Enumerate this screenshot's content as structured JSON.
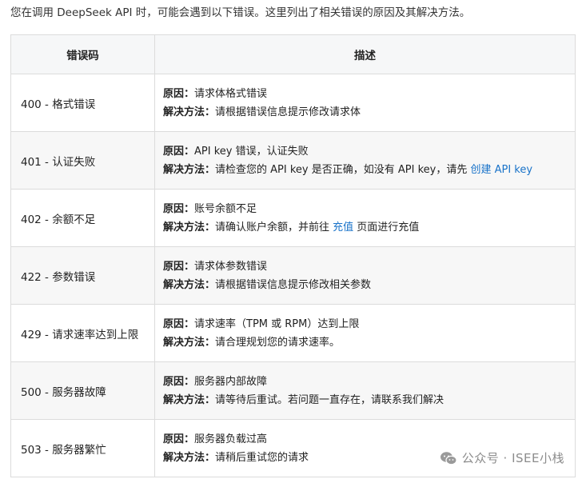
{
  "intro": "您在调用 DeepSeek API 时，可能会遇到以下错误。这里列出了相关错误的原因及其解决方法。",
  "headers": {
    "code": "错误码",
    "desc": "描述"
  },
  "labels": {
    "cause": "原因：",
    "fix": "解决方法："
  },
  "rows": [
    {
      "code": "400 - 格式错误",
      "cause": "请求体格式错误",
      "fix_pre": "请根据错误信息提示修改请求体",
      "fix_link": "",
      "fix_post": ""
    },
    {
      "code": "401 - 认证失败",
      "cause": "API key 错误，认证失败",
      "fix_pre": "请检查您的 API key 是否正确，如没有 API key，请先 ",
      "fix_link": "创建 API key",
      "fix_post": ""
    },
    {
      "code": "402 - 余额不足",
      "cause": "账号余额不足",
      "fix_pre": "请确认账户余额，并前往 ",
      "fix_link": "充值",
      "fix_post": " 页面进行充值"
    },
    {
      "code": "422 - 参数错误",
      "cause": "请求体参数错误",
      "fix_pre": "请根据错误信息提示修改相关参数",
      "fix_link": "",
      "fix_post": ""
    },
    {
      "code": "429 - 请求速率达到上限",
      "cause": "请求速率（TPM 或 RPM）达到上限",
      "fix_pre": "请合理规划您的请求速率。",
      "fix_link": "",
      "fix_post": ""
    },
    {
      "code": "500 - 服务器故障",
      "cause": "服务器内部故障",
      "fix_pre": "请等待后重试。若问题一直存在，请联系我们解决",
      "fix_link": "",
      "fix_post": ""
    },
    {
      "code": "503 - 服务器繁忙",
      "cause": "服务器负载过高",
      "fix_pre": "请稍后重试您的请求",
      "fix_link": "",
      "fix_post": ""
    }
  ],
  "watermark": "公众号 · ISEE小栈",
  "colors": {
    "link": "#1a73c9",
    "header_bg": "#f6f7f8",
    "alt_row_bg": "#f7f7f7",
    "border": "#dcdcdc"
  }
}
